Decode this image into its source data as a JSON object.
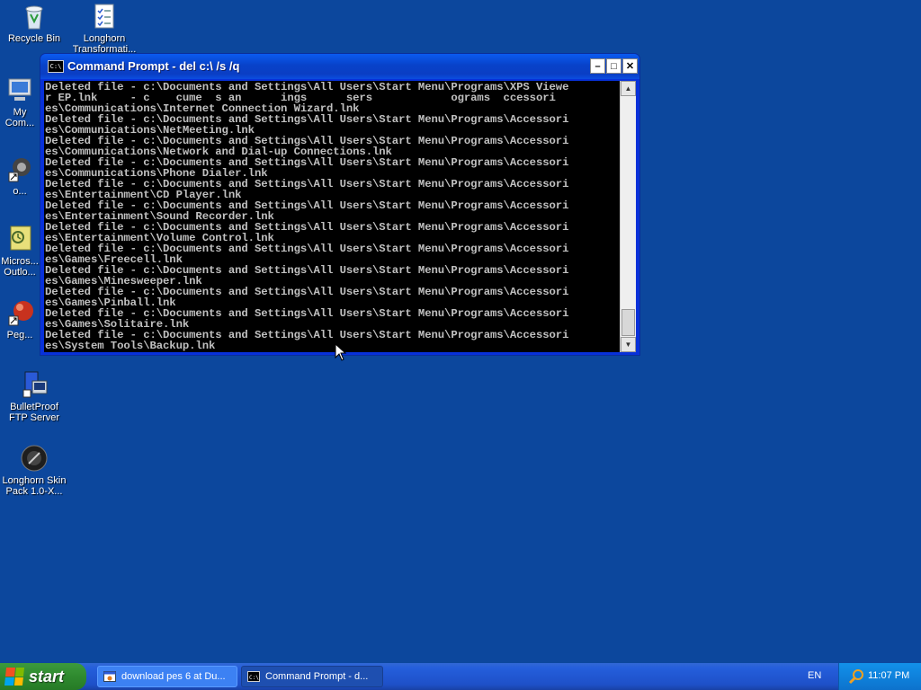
{
  "desktop": {
    "icons": [
      {
        "label": "Recycle Bin"
      },
      {
        "label": "Longhorn Transformati..."
      },
      {
        "label": "My Com..."
      },
      {
        "label": "o..."
      },
      {
        "label": "Micros... Outlo..."
      },
      {
        "label": "Peg..."
      },
      {
        "label": "BulletProof FTP Server"
      },
      {
        "label": "Longhorn Skin Pack 1.0-X..."
      }
    ]
  },
  "window": {
    "title": "Command Prompt - del c:\\ /s /q",
    "icon_text": "C:\\",
    "minimize_glyph": "–",
    "maximize_glyph": "□",
    "close_glyph": "✕",
    "output": "Deleted file - c:\\Documents and Settings\\All Users\\Start Menu\\Programs\\XPS Viewe\nr EP.lnk     - c    cume  s an      ings      sers            ograms  ccessori\nes\\Communications\\Internet Connection Wizard.lnk\nDeleted file - c:\\Documents and Settings\\All Users\\Start Menu\\Programs\\Accessori\nes\\Communications\\NetMeeting.lnk\nDeleted file - c:\\Documents and Settings\\All Users\\Start Menu\\Programs\\Accessori\nes\\Communications\\Network and Dial-up Connections.lnk\nDeleted file - c:\\Documents and Settings\\All Users\\Start Menu\\Programs\\Accessori\nes\\Communications\\Phone Dialer.lnk\nDeleted file - c:\\Documents and Settings\\All Users\\Start Menu\\Programs\\Accessori\nes\\Entertainment\\CD Player.lnk\nDeleted file - c:\\Documents and Settings\\All Users\\Start Menu\\Programs\\Accessori\nes\\Entertainment\\Sound Recorder.lnk\nDeleted file - c:\\Documents and Settings\\All Users\\Start Menu\\Programs\\Accessori\nes\\Entertainment\\Volume Control.lnk\nDeleted file - c:\\Documents and Settings\\All Users\\Start Menu\\Programs\\Accessori\nes\\Games\\Freecell.lnk\nDeleted file - c:\\Documents and Settings\\All Users\\Start Menu\\Programs\\Accessori\nes\\Games\\Minesweeper.lnk\nDeleted file - c:\\Documents and Settings\\All Users\\Start Menu\\Programs\\Accessori\nes\\Games\\Pinball.lnk\nDeleted file - c:\\Documents and Settings\\All Users\\Start Menu\\Programs\\Accessori\nes\\Games\\Solitaire.lnk\nDeleted file - c:\\Documents and Settings\\All Users\\Start Menu\\Programs\\Accessori\nes\\System Tools\\Backup.lnk"
  },
  "taskbar": {
    "start_label": "start",
    "tasks": [
      {
        "label": "download pes 6 at Du..."
      },
      {
        "label": "Command Prompt - d..."
      }
    ],
    "language": "EN",
    "clock": "11:07 PM"
  },
  "colors": {
    "desktop_bg": "#0c479d",
    "console_bg": "#000000",
    "console_fg": "#c0c0c0",
    "taskbar": "#245edb",
    "start": "#2f8a2f"
  }
}
